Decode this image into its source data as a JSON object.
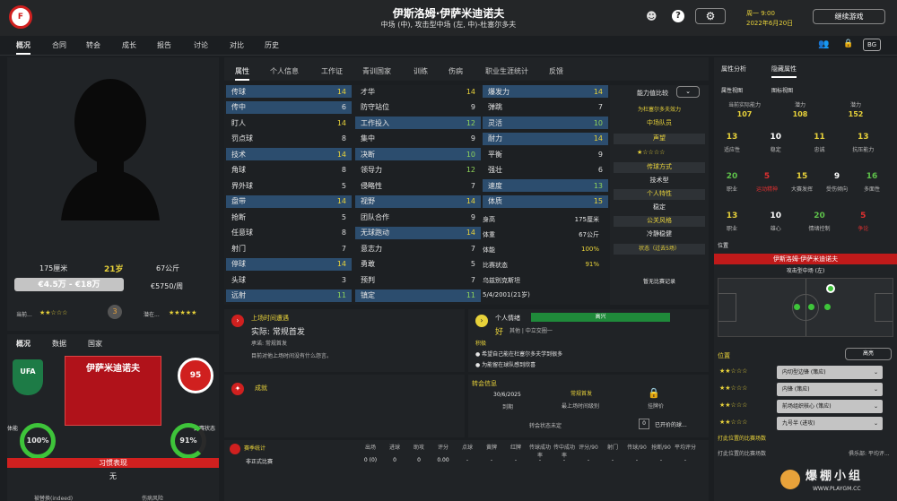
{
  "header": {
    "name": "伊斯洛姆·伊萨米迪诺夫",
    "positions": "中场 (中), 攻击型中场 (左, 中)-杜塞尔多夫",
    "clock": "周一 9:00",
    "date": "2022年6月20日",
    "continue_label": "继续游戏"
  },
  "nav": [
    "概况",
    "合同",
    "转会",
    "成长",
    "报告",
    "讨论",
    "对比",
    "历史"
  ],
  "profile": {
    "height": "175厘米",
    "age": "21岁",
    "weight": "67公斤",
    "value": "€4.5万 - €18万",
    "wage": "€5750/周",
    "current_label": "当前...",
    "potential_label": "潜在..."
  },
  "left_tabs": [
    "概况",
    "数据",
    "国家"
  ],
  "card": {
    "name": "伊萨米迪诺夫",
    "club_badge": "95",
    "condition_label": "体能",
    "condition": "100%",
    "match_label": "比赛状态",
    "match": "91%",
    "habit_label": "习惯表现",
    "habit_value": "无",
    "bottom_left": "被替换(indeed)",
    "bottom_right": "伤病风险"
  },
  "attr_tabs": [
    "属性",
    "个人信息",
    "工作证",
    "青训国家",
    "训练",
    "伤病",
    "职业生涯统计",
    "反馈"
  ],
  "technical": [
    [
      "传球",
      "14"
    ],
    [
      "传中",
      "6"
    ],
    [
      "盯人",
      "14"
    ],
    [
      "罚点球",
      "8"
    ],
    [
      "技术",
      "14"
    ],
    [
      "角球",
      "8"
    ],
    [
      "界外球",
      "5"
    ],
    [
      "盘带",
      "14"
    ],
    [
      "抢断",
      "5"
    ],
    [
      "任意球",
      "8"
    ],
    [
      "射门",
      "7"
    ],
    [
      "停球",
      "14"
    ],
    [
      "头球",
      "3"
    ],
    [
      "远射",
      "11"
    ]
  ],
  "mental": [
    [
      "才华",
      "14"
    ],
    [
      "防守站位",
      "9"
    ],
    [
      "工作投入",
      "12"
    ],
    [
      "集中",
      "9"
    ],
    [
      "决断",
      "10"
    ],
    [
      "领导力",
      "12"
    ],
    [
      "侵略性",
      "7"
    ],
    [
      "视野",
      "14"
    ],
    [
      "团队合作",
      "9"
    ],
    [
      "无球跑动",
      "14"
    ],
    [
      "意志力",
      "7"
    ],
    [
      "勇敢",
      "5"
    ],
    [
      "预判",
      "7"
    ],
    [
      "镇定",
      "11"
    ]
  ],
  "physical": [
    [
      "爆发力",
      "14"
    ],
    [
      "弹跳",
      "7"
    ],
    [
      "灵活",
      "10"
    ],
    [
      "耐力",
      "14"
    ],
    [
      "平衡",
      "9"
    ],
    [
      "强壮",
      "6"
    ],
    [
      "速度",
      "13"
    ],
    [
      "体质",
      "15"
    ]
  ],
  "info": {
    "height_l": "身高",
    "height": "175厘米",
    "weight_l": "体重",
    "weight": "67公斤",
    "cond_l": "体能",
    "cond": "100%",
    "match_l": "比赛状态",
    "match": "91%",
    "nation": "乌兹别克斯坦",
    "dob": "5/4/2001(21岁)"
  },
  "ability": {
    "label": "能力值比较",
    "club": "为杜塞尔多夫效力",
    "role": "中场队员",
    "rep_l": "声望",
    "style_l": "传球方式",
    "style": "技术型",
    "trait_l": "个人特性",
    "trait": "稳定",
    "pr_l": "公关风格",
    "pr": "冷静稳健",
    "status": "状态（过去5场）",
    "no_record": "暂无比赛记录"
  },
  "playtime": {
    "title": "上场时间遭遇",
    "value": "实际: 常规首发",
    "promise": "承诺: 常规首发",
    "note": "目前对他上场时间没有什么怨言。"
  },
  "mood": {
    "title": "个人情绪",
    "bar": "高兴",
    "word": "好",
    "other": "其他 | 中立交圈一",
    "positive": "积极",
    "p1": "希望自己能在杜塞尔多夫学到很多",
    "p2": "为能留在球队感到欣喜"
  },
  "achievements": {
    "title": "成就"
  },
  "transfer": {
    "title": "转会信息",
    "date": "30/6/2025",
    "date_l": "到期",
    "status": "常规首发",
    "status_l": "最上场时间级别",
    "lock_l": "挂牌价",
    "state": "转会状态未定",
    "offers_n": "0",
    "offers": "已开价的球..."
  },
  "season": {
    "title": "赛季统计",
    "cols": [
      "出场",
      "进球",
      "助攻",
      "评分",
      "点球",
      "黄牌",
      "红牌",
      "传球成功率",
      "传中成功率",
      "评分/90",
      "射门",
      "传球/90",
      "抢断/90",
      "平均评分"
    ],
    "row_label": "非正式比赛",
    "row": [
      "0 (0)",
      "0",
      "0",
      "0.00",
      "-",
      "-",
      "-",
      "-",
      "-",
      "-",
      "-",
      "-",
      "-",
      "-"
    ]
  },
  "right": {
    "tabs": [
      "属性分析",
      "隐藏属性"
    ],
    "subtabs": [
      "属性视图",
      "图标视图"
    ],
    "top": [
      [
        "当前实际能力",
        "107"
      ],
      [
        "潜力",
        "108"
      ],
      [
        "潜力",
        "152"
      ]
    ],
    "hidden": [
      [
        "13",
        "适应性"
      ],
      [
        "10",
        "稳定"
      ],
      [
        "11",
        "忠诚"
      ],
      [
        "13",
        "抗压能力"
      ],
      [
        "20",
        "职业"
      ],
      [
        "5",
        "运动精神"
      ],
      [
        "15",
        "大赛发挥"
      ],
      [
        "9",
        "受伤倾向"
      ],
      [
        "16",
        "多面性"
      ],
      [
        "13",
        "职业"
      ],
      [
        "10",
        "雄心"
      ],
      [
        "20",
        "情绪控制"
      ],
      [
        "5",
        "争论"
      ]
    ],
    "pos_label": "位置",
    "pos_name": "伊斯洛姆·伊萨米迪诺夫",
    "pos_role": "攻击型中场 (左)",
    "roles_label": "位置",
    "roles_btn": "高亮",
    "roles": [
      "内切型边锋 (策应)",
      "内锋 (策应)",
      "前场组织核心 (策应)",
      "九号半 (进攻)"
    ],
    "bottom_label": "打此位置的比赛场数",
    "bottom_sub": "打此位置的比赛场数",
    "bottom_right": "俱乐部: 平均评..."
  },
  "watermark": "爆棚小组",
  "watermark_url": "WWW.PLAYGM.CC"
}
